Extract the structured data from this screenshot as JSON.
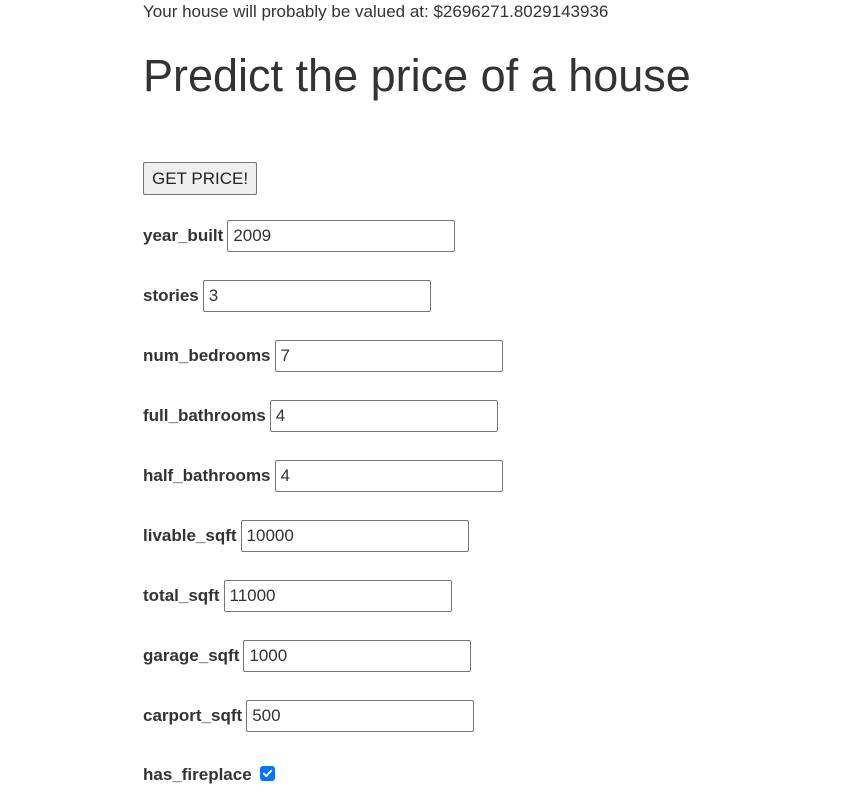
{
  "result": {
    "text": "Your house will probably be valued at: $2696271.8029143936"
  },
  "title": "Predict the price of a house",
  "submit_button": {
    "label": "GET PRICE!"
  },
  "fields": {
    "year_built": {
      "label": "year_built",
      "value": "2009"
    },
    "stories": {
      "label": "stories",
      "value": "3"
    },
    "num_bedrooms": {
      "label": "num_bedrooms",
      "value": "7"
    },
    "full_bathrooms": {
      "label": "full_bathrooms",
      "value": "4"
    },
    "half_bathrooms": {
      "label": "half_bathrooms",
      "value": "4"
    },
    "livable_sqft": {
      "label": "livable_sqft",
      "value": "10000"
    },
    "total_sqft": {
      "label": "total_sqft",
      "value": "11000"
    },
    "garage_sqft": {
      "label": "garage_sqft",
      "value": "1000"
    },
    "carport_sqft": {
      "label": "carport_sqft",
      "value": "500"
    },
    "has_fireplace": {
      "label": "has_fireplace",
      "checked": true
    }
  },
  "colors": {
    "text": "#333333",
    "checkbox_accent": "#0075ff",
    "input_border": "#767676"
  }
}
